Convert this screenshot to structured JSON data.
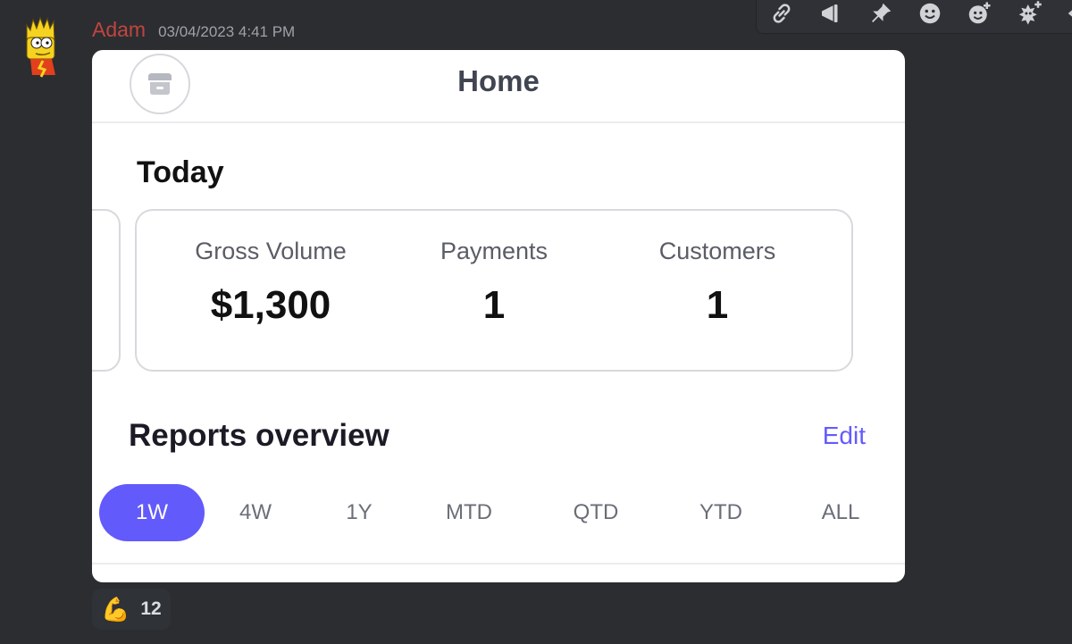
{
  "message": {
    "author": "Adam",
    "timestamp": "03/04/2023 4:41 PM",
    "author_color": "#c1453e"
  },
  "toolbar": {
    "icons": [
      "link-icon",
      "megaphone-icon",
      "pin-icon",
      "emoji-icon",
      "add-reaction-icon",
      "add-super-reaction-icon",
      "reply-icon"
    ]
  },
  "screenshot": {
    "header": {
      "title": "Home"
    },
    "today": {
      "heading": "Today",
      "stats": [
        {
          "label": "Gross Volume",
          "value": "$1,300"
        },
        {
          "label": "Payments",
          "value": "1"
        },
        {
          "label": "Customers",
          "value": "1"
        }
      ]
    },
    "reports": {
      "heading": "Reports overview",
      "edit_label": "Edit",
      "periods": [
        "1W",
        "4W",
        "1Y",
        "MTD",
        "QTD",
        "YTD",
        "ALL"
      ],
      "active_period": "1W"
    },
    "accent_color": "#625afa"
  },
  "reaction": {
    "emoji": "💪",
    "count": "12"
  }
}
